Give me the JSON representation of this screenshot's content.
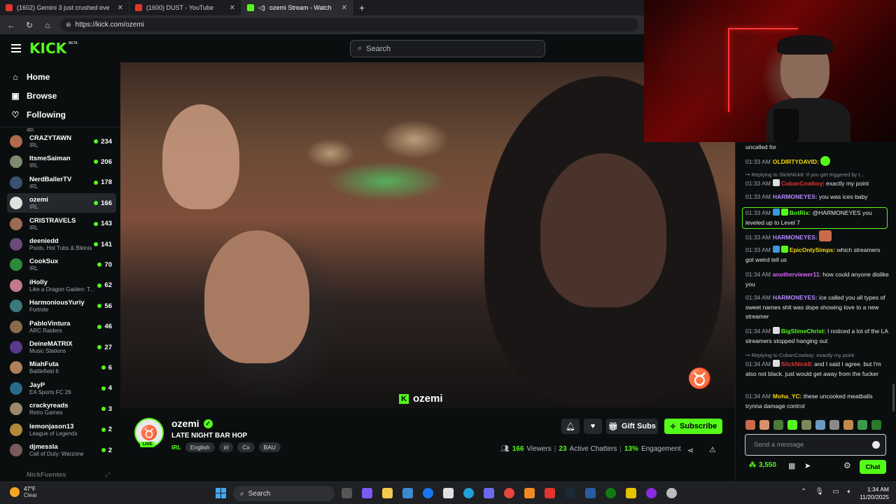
{
  "browser": {
    "tabs": [
      {
        "title": "(1602) Gemini 3 just crushed eve",
        "color": "#e3342f"
      },
      {
        "title": "(1600) DUST - YouTube",
        "color": "#e3342f"
      },
      {
        "title": "ozemi Stream - Watch Live o",
        "color": "#53fc18"
      }
    ],
    "url": "https://kick.com/ozemi"
  },
  "header": {
    "logo": "KICK",
    "beta": "BETA",
    "search_placeholder": "Search"
  },
  "sidebar": {
    "nav": [
      {
        "label": "Home",
        "icon": "⌂"
      },
      {
        "label": "Browse",
        "icon": "▣"
      },
      {
        "label": "Following",
        "icon": "♡"
      }
    ],
    "clipped_top": "IRL",
    "channels": [
      {
        "name": "CRAZYTAWN",
        "category": "IRL",
        "viewers": "234",
        "color": "#b06a4e"
      },
      {
        "name": "ItsmeSaiman",
        "category": "IRL",
        "viewers": "206",
        "color": "#7c8a6e"
      },
      {
        "name": "NerdBallerTV",
        "category": "IRL",
        "viewers": "178",
        "color": "#3a5070"
      },
      {
        "name": "ozemi",
        "category": "IRL",
        "viewers": "166",
        "color": "#e0e0e0"
      },
      {
        "name": "CRISTRAVELS",
        "category": "IRL",
        "viewers": "143",
        "color": "#9a6c50"
      },
      {
        "name": "deeniedd",
        "category": "Pools, Hot Tubs & Bikinis",
        "viewers": "141",
        "color": "#6a4a7a"
      },
      {
        "name": "CookSux",
        "category": "IRL",
        "viewers": "70",
        "color": "#2a8a3a"
      },
      {
        "name": "iHolly",
        "category": "Like a Dragon Gaiden: T...",
        "viewers": "62",
        "color": "#c27a8a"
      },
      {
        "name": "HarmoniousYuriy",
        "category": "Fortnite",
        "viewers": "56",
        "color": "#3a7a7a"
      },
      {
        "name": "PabloVintura",
        "category": "ARC Raiders",
        "viewers": "46",
        "color": "#8a6a4a"
      },
      {
        "name": "DeineMATRIX",
        "category": "Music Stations",
        "viewers": "27",
        "color": "#5a3a8a"
      },
      {
        "name": "MiahFuta",
        "category": "Battlefield 6",
        "viewers": "6",
        "color": "#b0805a"
      },
      {
        "name": "JayP",
        "category": "EA Sports FC 26",
        "viewers": "4",
        "color": "#2a6a8a"
      },
      {
        "name": "crackyreads",
        "category": "Retro Games",
        "viewers": "3",
        "color": "#9a8a6a"
      },
      {
        "name": "lemonjason13",
        "category": "League of Legends",
        "viewers": "2",
        "color": "#b08a3a"
      },
      {
        "name": "djmessla",
        "category": "Call of Duty: Warzone",
        "viewers": "2",
        "color": "#7a5a5a"
      }
    ],
    "footer_channel": "NickFuentes"
  },
  "video": {
    "watermark": "ozemi"
  },
  "channel": {
    "name": "ozemi",
    "live": "LIVE",
    "title": "LATE NIGHT BAR HOP",
    "category": "IRL",
    "tags": [
      "English",
      "irl",
      "Cx",
      "BAU"
    ],
    "gift_subs": "Gift Subs",
    "subscribe": "Subscribe",
    "viewers": "166",
    "viewers_label": "Viewers",
    "chatters": "23",
    "chatters_label": "Active Chatters",
    "engagement": "13%",
    "engagement_label": "Engagement"
  },
  "chat": {
    "messages": [
      {
        "time": "",
        "user": "",
        "text": "uncalled for",
        "color": "#ffffff"
      },
      {
        "time": "01:33 AM",
        "user": "OLDIRTYDAVID:",
        "text": "",
        "color": "#f5d90a"
      },
      {
        "reply": "↪ Replying to SlickNick8: If you get triggered by t..."
      },
      {
        "time": "01:33 AM",
        "user": "CubanCowboy",
        "text": ": exactly my point",
        "color": "#e3342f"
      },
      {
        "time": "01:33 AM",
        "user": "HARMONEYES:",
        "text": " you was ices baby",
        "color": "#b388ff"
      },
      {
        "time": "01:33 AM",
        "user": "BotRix:",
        "text": " @HARMONEYES you leveled up to Level 7",
        "color": "#53fc18"
      },
      {
        "time": "01:33 AM",
        "user": "HARMONEYES:",
        "text": "",
        "color": "#b388ff"
      },
      {
        "time": "01:33 AM",
        "user": "EpicOnlySimps:",
        "text": " which streamers got weird tell us",
        "color": "#f5d90a"
      },
      {
        "time": "01:34 AM",
        "user": "anotherviewer11",
        "text": ": how could anyone dislike you",
        "color": "#d966ff"
      },
      {
        "time": "01:34 AM",
        "user": "HARMONEYES:",
        "text": " ice called you all types of sweet names shit was dope showing love to a new streamer",
        "color": "#b388ff"
      },
      {
        "time": "01:34 AM",
        "user": "BigSlimeChrist:",
        "text": " I noticed a lot of the LA streamers stopped hanging out",
        "color": "#53fc18"
      },
      {
        "reply": "↪ Replying to CubanCowboy: exactly my point"
      },
      {
        "time": "01:34 AM",
        "user": "SlickNick8",
        "text": ": and I said I agree. but I'm also not black. just would get away from the fucker",
        "color": "#e3342f"
      },
      {
        "time": "01:34 AM",
        "user": "Moha_YC:",
        "text": " these uncooked meatballs trynna damage control",
        "color": "#f5d90a"
      }
    ],
    "input_placeholder": "Send a message",
    "points": "3,550",
    "chat_button": "Chat"
  },
  "taskbar": {
    "temp": "47°F",
    "weather": "Clear",
    "search": "Search",
    "time": "1:34 AM",
    "date": "11/20/2025"
  }
}
